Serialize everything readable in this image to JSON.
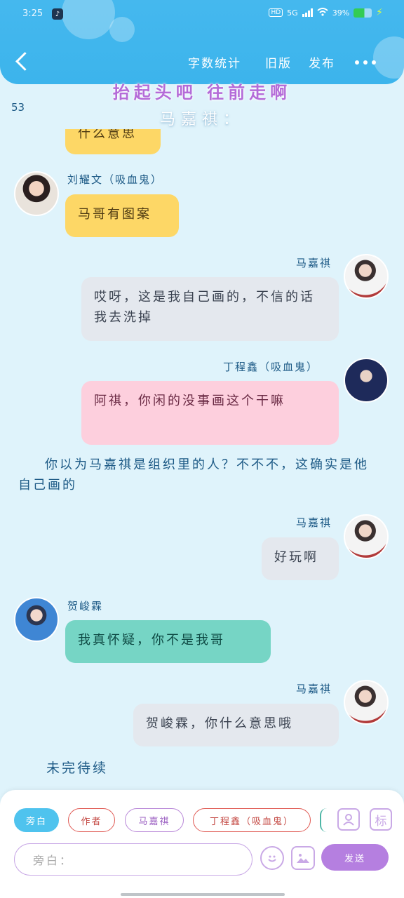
{
  "status_bar": {
    "time": "3:25",
    "hd": "HD",
    "network": "5G",
    "battery": "39%"
  },
  "header": {
    "back_icon": "chevron-left-icon",
    "word_count_label": "字数统计",
    "old_version_label": "旧版",
    "publish_label": "发布",
    "more_icon": "more-dots-icon"
  },
  "chapter": {
    "title": "抬起头吧 往前走啊",
    "count": "53",
    "speaker_partial": "马嘉祺："
  },
  "messages": [
    {
      "speaker": "",
      "text": "什么意思",
      "side": "left",
      "color": "yellow"
    },
    {
      "speaker": "刘耀文（吸血鬼）",
      "text": "马哥有图案",
      "side": "left",
      "color": "yellow"
    },
    {
      "speaker": "马嘉祺",
      "text": "哎呀，这是我自己画的，不信的话我去洗掉",
      "side": "right",
      "color": "gray"
    },
    {
      "speaker": "丁程鑫（吸血鬼）",
      "text": "阿祺，你闲的没事画这个干嘛",
      "side": "right",
      "color": "pink"
    },
    {
      "speaker": "马嘉祺",
      "text": "好玩啊",
      "side": "right",
      "color": "gray"
    },
    {
      "speaker": "贺峻霖",
      "text": "我真怀疑，你不是我哥",
      "side": "left",
      "color": "teal"
    },
    {
      "speaker": "马嘉祺",
      "text": "贺峻霖，你什么意思哦",
      "side": "right",
      "color": "gray"
    }
  ],
  "narration": "你以为马嘉祺是组织里的人？不不不，这确实是他自己画的",
  "ending": "未完待续",
  "composer": {
    "roles": [
      "旁白",
      "作者",
      "马嘉祺",
      "丁程鑫（吸血鬼）"
    ],
    "input_placeholder": "旁白：",
    "send_label": "发送",
    "tag_label": "标",
    "icons": [
      "person-icon",
      "tag-icon",
      "emoji-icon",
      "image-icon"
    ]
  },
  "colors": {
    "header": "#45b8ee",
    "background": "#dff3fb",
    "yellow_bubble": "#fdd766",
    "gray_bubble": "#e4e8ee",
    "pink_bubble": "#fdcfdd",
    "teal_bubble": "#76d5c5",
    "send_button": "#b57fe0"
  }
}
